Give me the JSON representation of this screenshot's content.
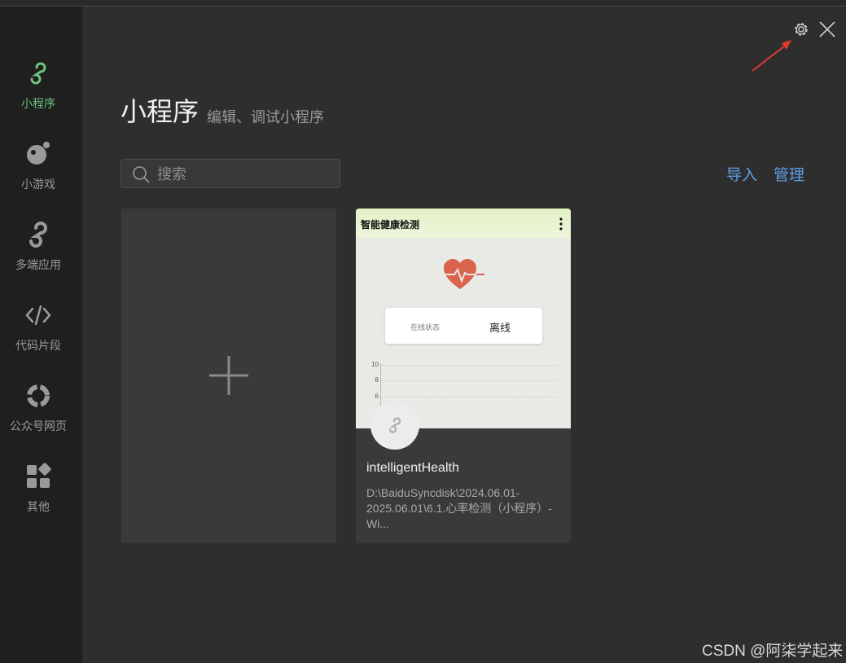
{
  "sidebar": {
    "items": [
      {
        "label": "小程序",
        "icon": "miniprogram-icon",
        "active": true
      },
      {
        "label": "小游戏",
        "icon": "game-icon"
      },
      {
        "label": "多端应用",
        "icon": "multi-app-icon"
      },
      {
        "label": "代码片段",
        "icon": "code-icon"
      },
      {
        "label": "公众号网页",
        "icon": "webpage-icon"
      },
      {
        "label": "其他",
        "icon": "grid-icon"
      }
    ]
  },
  "header": {
    "title": "小程序",
    "subtitle": "编辑、调试小程序"
  },
  "search": {
    "placeholder": "搜索"
  },
  "actions": {
    "import": "导入",
    "manage": "管理"
  },
  "project": {
    "preview_title": "智能健康检测",
    "status_label": "在线状态",
    "status_value": "离线",
    "chart_ticks": [
      "10",
      "8",
      "6"
    ],
    "name": "intelligentHealth",
    "path": "D:\\BaiduSyncdisk\\2024.06.01-2025.06.01\\6.1.心率检测（小程序）-Wi..."
  },
  "watermark": "CSDN @阿柒学起来",
  "colors": {
    "accent": "#6bc37d",
    "link": "#5fa0e6",
    "arrow": "#e03a2f",
    "heart": "#d9634d"
  }
}
